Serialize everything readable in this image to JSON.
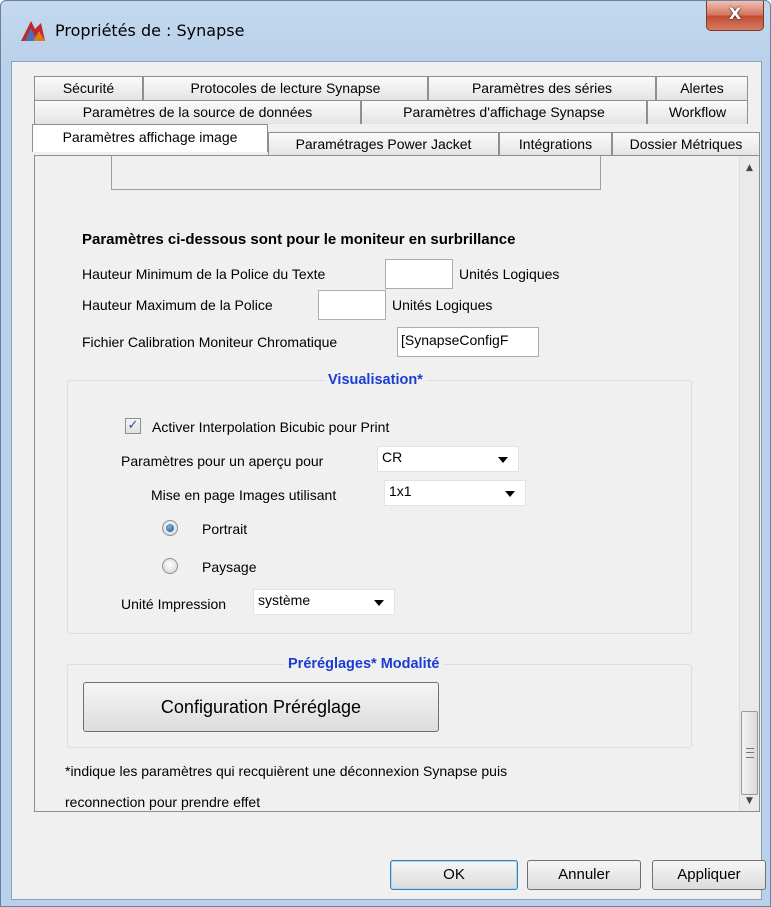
{
  "window": {
    "title": "Propriétés de : Synapse",
    "close_label": "X"
  },
  "tabs": {
    "row1": [
      {
        "label": "Sécurité"
      },
      {
        "label": "Protocoles de lecture Synapse"
      },
      {
        "label": "Paramètres des séries"
      },
      {
        "label": "Alertes"
      }
    ],
    "row2": [
      {
        "label": "Paramètres de la source de données"
      },
      {
        "label": "Paramètres d'affichage Synapse"
      },
      {
        "label": "Workflow"
      }
    ],
    "row3": [
      {
        "label": "Paramètres affichage image",
        "active": true
      },
      {
        "label": "Paramétrages Power Jacket"
      },
      {
        "label": "Intégrations"
      },
      {
        "label": "Dossier Métriques"
      }
    ]
  },
  "monitor_section": {
    "heading": "Paramètres ci-dessous sont pour le moniteur en surbrillance",
    "min_font_label": "Hauteur Minimum de la Police du Texte",
    "min_font_value": "",
    "min_font_unit": "Unités Logiques",
    "max_font_label": "Hauteur Maximum de la Police",
    "max_font_value": "",
    "max_font_unit": "Unités Logiques",
    "calibration_label": "Fichier Calibration Moniteur Chromatique",
    "calibration_value": "[SynapseConfigF"
  },
  "visualisation": {
    "legend": "Visualisation*",
    "bicubic_label": "Activer Interpolation Bicubic pour Print",
    "bicubic_checked": true,
    "bicubic_mark": "✓",
    "preview_label": "Paramètres pour un aperçu pour",
    "preview_value": "CR",
    "layout_label": "Mise en page Images utilisant",
    "layout_value": "1x1",
    "portrait_label": "Portrait",
    "landscape_label": "Paysage",
    "orientation_selected": "Portrait",
    "print_unit_label": "Unité Impression",
    "print_unit_value": "système"
  },
  "presets": {
    "legend": "Préréglages* Modalité",
    "button_label": "Configuration Préréglage"
  },
  "footnote": {
    "line1": "*indique les paramètres qui recquièrent une déconnexion Synapse puis",
    "line2": "reconnection pour prendre effet"
  },
  "buttons": {
    "ok": "OK",
    "cancel": "Annuler",
    "apply": "Appliquer"
  },
  "scrollbar": {
    "up_glyph": "▲",
    "down_glyph": "▼"
  },
  "colors": {
    "legend_blue": "#1a3dd1",
    "title_bar": "#b9d1ea"
  }
}
